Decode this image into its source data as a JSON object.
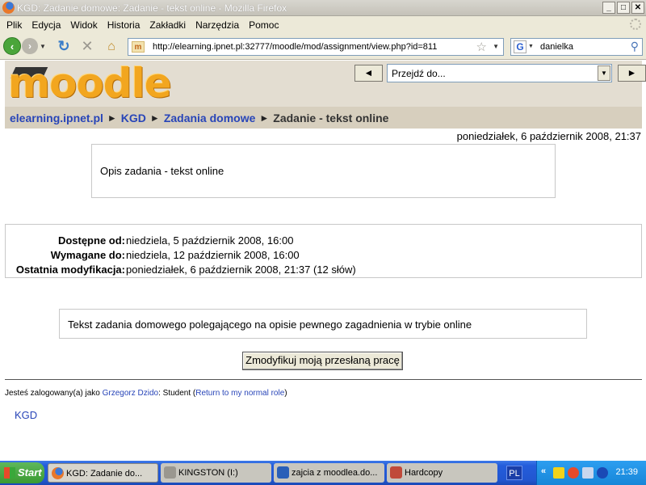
{
  "window": {
    "title": "KGD: Zadanie domowe: Zadanie - tekst online - Mozilla Firefox",
    "min": "_",
    "max": "□",
    "close": "✕"
  },
  "menu": [
    "Plik",
    "Edycja",
    "Widok",
    "Historia",
    "Zakładki",
    "Narzędzia",
    "Pomoc"
  ],
  "nav": {
    "url": "http://elearning.ipnet.pl:32777/moodle/mod/assignment/view.php?id=811",
    "search_value": "danielka",
    "favicon": "m",
    "search_engine": "G"
  },
  "header": {
    "logo": "moodle",
    "jump_placeholder": "Przejdź do...",
    "prev": "◄",
    "next": "►"
  },
  "breadcrumb": {
    "site": "elearning.ipnet.pl",
    "course": "KGD",
    "section": "Zadania domowe",
    "current": "Zadanie - tekst online",
    "separator": "►"
  },
  "date": "poniedziałek, 6 październik 2008, 21:37",
  "description": "Opis zadania - tekst online",
  "info": {
    "available_label": "Dostępne od:",
    "available_value": "niedziela, 5 październik 2008, 16:00",
    "due_label": "Wymagane do:",
    "due_value": "niedziela, 12 październik 2008, 16:00",
    "modified_label": "Ostatnia modyfikacja:",
    "modified_value": "poniedziałek, 6 październik 2008, 21:37 (12 słów)"
  },
  "submission_text": "Tekst zadania domowego polegającego na opisie pewnego zagadnienia w trybie online",
  "edit_button": "Zmodyfikuj moją przesłaną pracę",
  "footer": {
    "logged_prefix": "Jesteś zalogowany(a) jako",
    "user": "Grzegorz Dzido",
    "role_text": ": Student (",
    "role_link": "Return to my normal role",
    "role_close": ")",
    "course_link": "KGD"
  },
  "taskbar": {
    "start": "Start",
    "tasks": [
      "KGD: Zadanie do...",
      "KINGSTON (I:)",
      "zajcia z moodlea.do...",
      "Hardcopy"
    ],
    "lang": "PL",
    "clock": "21:39"
  },
  "colors": {
    "link": "#2845b8",
    "taskbar": "#245ddb",
    "header": "#e3ddd1"
  }
}
